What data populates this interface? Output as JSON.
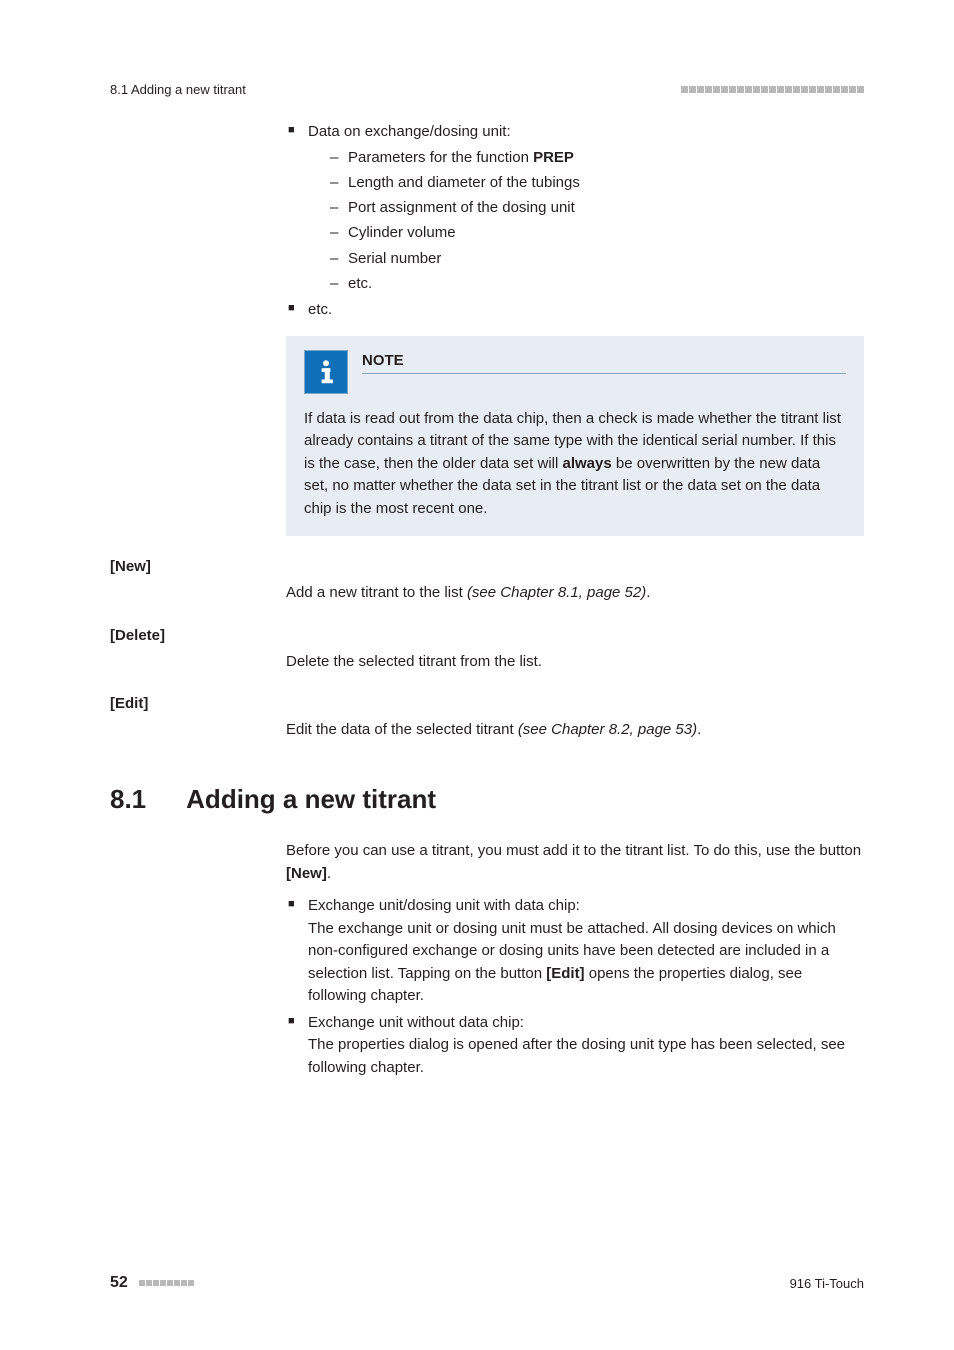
{
  "header": {
    "section_ref": "8.1 Adding a new titrant"
  },
  "list1": {
    "item1_text": "Data on exchange/dosing unit:",
    "sub": {
      "s1_pre": "Parameters for the function ",
      "s1_bold": "PREP",
      "s2": "Length and diameter of the tubings",
      "s3": "Port assignment of the dosing unit",
      "s4": "Cylinder volume",
      "s5": "Serial number",
      "s6": "etc."
    },
    "item2_text": "etc."
  },
  "note": {
    "title": "NOTE",
    "body_a": "If data is read out from the data chip, then a check is made whether the titrant list already contains a titrant of the same type with the identical serial number. If this is the case, then the older data set will ",
    "body_bold": "always",
    "body_b": " be overwritten by the new data set, no matter whether the data set in the titrant list or the data set on the data chip is the most recent one."
  },
  "defs": {
    "new": {
      "term": "[New]",
      "desc_a": "Add a new titrant to the list ",
      "desc_i": "(see Chapter 8.1, page 52)",
      "desc_b": "."
    },
    "delete": {
      "term": "[Delete]",
      "desc": "Delete the selected titrant from the list."
    },
    "edit": {
      "term": "[Edit]",
      "desc_a": "Edit the data of the selected titrant ",
      "desc_i": "(see Chapter 8.2, page 53)",
      "desc_b": "."
    }
  },
  "h2": {
    "num": "8.1",
    "text": "Adding a new titrant"
  },
  "intro": {
    "a": "Before you can use a titrant, you must add it to the titrant list. To do this, use the button ",
    "b_bold": "[New]",
    "c": "."
  },
  "list2": {
    "i1_head": "Exchange unit/dosing unit with data chip:",
    "i1_body_a": "The exchange unit or dosing unit must be attached. All dosing devices on which non-configured exchange or dosing units have been detected are included in a selection list. Tapping on the button ",
    "i1_body_bold": "[Edit]",
    "i1_body_b": " opens the properties dialog, see following chapter.",
    "i2_head": "Exchange unit without data chip:",
    "i2_body": "The properties dialog is opened after the dosing unit type has been selected, see following chapter."
  },
  "footer": {
    "page": "52",
    "product": "916 Ti-Touch"
  }
}
